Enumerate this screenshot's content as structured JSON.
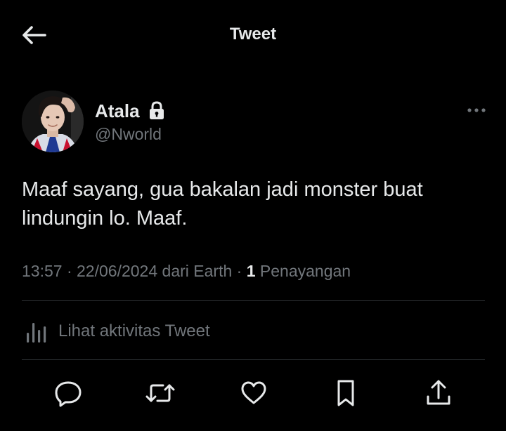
{
  "header": {
    "title": "Tweet",
    "back_icon": "arrow-left-icon"
  },
  "author": {
    "display_name": "Atala",
    "handle": "@Nworld",
    "protected_icon": "lock-icon",
    "more_icon": "more-horizontal-icon"
  },
  "tweet": {
    "text": "Maaf sayang, gua bakalan jadi monster buat lindungin lo. Maaf.",
    "time": "13:57",
    "separator1": " · ",
    "date": "22/06/2024",
    "source": " dari Earth",
    "separator2": " · ",
    "views_count": "1",
    "views_label": " Penayangan"
  },
  "activity": {
    "label": "Lihat aktivitas Tweet",
    "icon": "analytics-bars-icon"
  },
  "actions": [
    {
      "name": "reply",
      "icon": "reply-icon"
    },
    {
      "name": "retweet",
      "icon": "retweet-icon"
    },
    {
      "name": "like",
      "icon": "heart-icon"
    },
    {
      "name": "bookmark",
      "icon": "bookmark-icon"
    },
    {
      "name": "share",
      "icon": "share-icon"
    }
  ],
  "colors": {
    "background": "#000000",
    "text_primary": "#e7e9ea",
    "text_secondary": "#71767b",
    "divider": "#2f3336"
  }
}
